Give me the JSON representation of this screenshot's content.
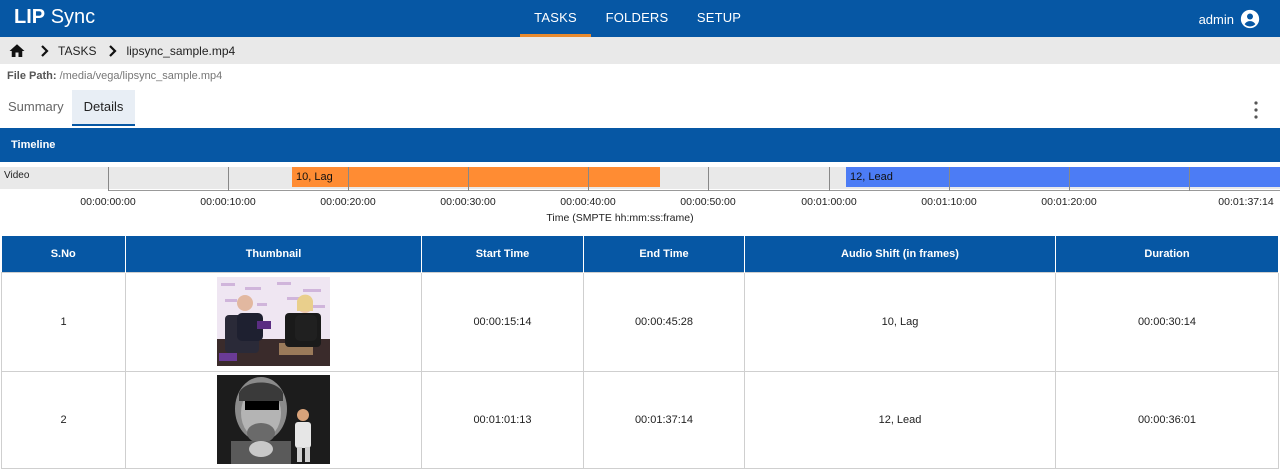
{
  "app": {
    "logo_bold": "LIP",
    "logo_light": "Sync"
  },
  "nav": {
    "items": [
      "TASKS",
      "FOLDERS",
      "SETUP"
    ],
    "active": "TASKS",
    "accent": "#e88a2e",
    "bar_color": "#0657a4"
  },
  "user": {
    "name": "admin",
    "icon": "account-circle-icon"
  },
  "breadcrumb": {
    "items": [
      "TASKS",
      "lipsync_sample.mp4"
    ]
  },
  "file_path": {
    "label": "File Path:",
    "value": "/media/vega/lipsync_sample.mp4"
  },
  "tabs": [
    {
      "label": "Summary",
      "active": false
    },
    {
      "label": "Details",
      "active": true
    }
  ],
  "timeline": {
    "title": "Timeline",
    "track_label": "Video",
    "segments": [
      {
        "label": "10, Lag",
        "start": "00:00:15:14",
        "end": "00:00:45:28",
        "color": "#ff8c33"
      },
      {
        "label": "12, Lead",
        "start": "00:01:01:13",
        "end": "00:01:37:14",
        "color": "#4c7cf5"
      }
    ],
    "ticks": [
      "00:00:00:00",
      "00:00:10:00",
      "00:00:20:00",
      "00:00:30:00",
      "00:00:40:00",
      "00:00:50:00",
      "00:01:00:00",
      "00:01:10:00",
      "00:01:20:00",
      "00:01:37:14"
    ],
    "axis_title": "Time (SMPTE hh:mm:ss:frame)"
  },
  "table": {
    "headers": [
      "S.No",
      "Thumbnail",
      "Start Time",
      "End Time",
      "Audio Shift (in frames)",
      "Duration"
    ],
    "rows": [
      {
        "sno": "1",
        "thumb": "talk-show-thumbnail",
        "start": "00:00:15:14",
        "end": "00:00:45:28",
        "shift": "10, Lag",
        "duration": "00:00:30:14"
      },
      {
        "sno": "2",
        "thumb": "black-white-thumbnail",
        "start": "00:01:01:13",
        "end": "00:01:37:14",
        "shift": "12, Lead",
        "duration": "00:00:36:01"
      }
    ]
  }
}
